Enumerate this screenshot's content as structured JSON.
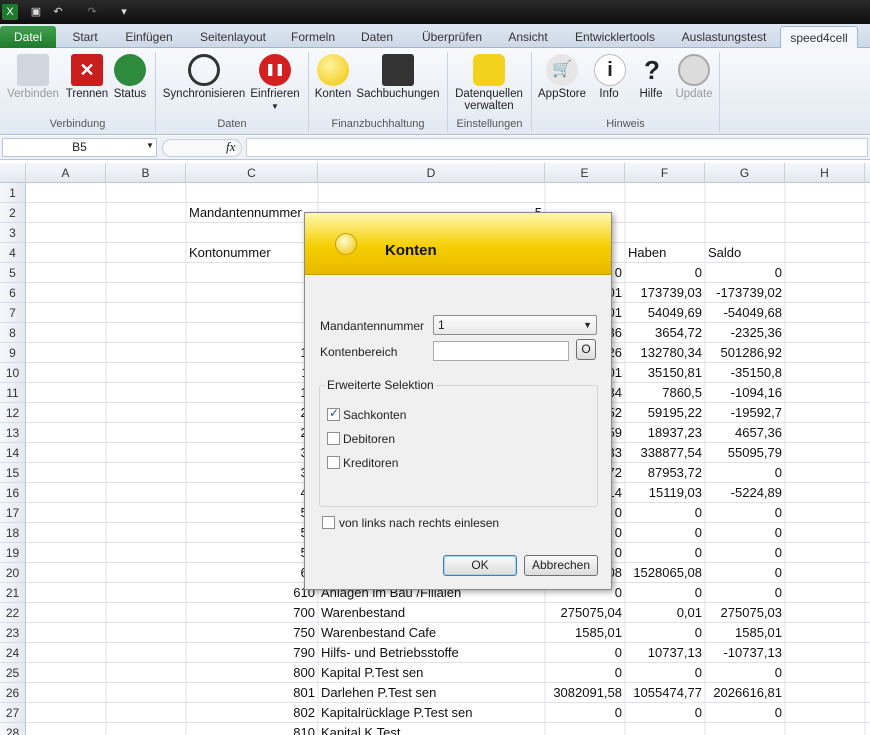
{
  "quick_access": {
    "save": "save-icon",
    "undo": "undo-icon",
    "redo": "redo-icon"
  },
  "tabs": [
    {
      "label": "Datei"
    },
    {
      "label": "Start"
    },
    {
      "label": "Einfügen"
    },
    {
      "label": "Seitenlayout"
    },
    {
      "label": "Formeln"
    },
    {
      "label": "Daten"
    },
    {
      "label": "Überprüfen"
    },
    {
      "label": "Ansicht"
    },
    {
      "label": "Entwicklertools"
    },
    {
      "label": "Auslastungstest"
    },
    {
      "label": "speed4cell"
    }
  ],
  "ribbon": {
    "buttons": [
      "Verbinden",
      "Trennen",
      "Status",
      "Synchronisieren",
      "Einfrieren",
      "Konten",
      "Sachbuchungen",
      "Datenquellen",
      "verwalten",
      "AppStore",
      "Info",
      "Hilfe",
      "Update"
    ],
    "groups": [
      "Verbindung",
      "Daten",
      "Finanzbuchhaltung",
      "Einstellungen",
      "Hinweis"
    ]
  },
  "formula_bar": {
    "name_box": "B5",
    "fx": "fx"
  },
  "columns": [
    "A",
    "B",
    "C",
    "D",
    "E",
    "F",
    "G",
    "H"
  ],
  "rows": [
    "1",
    "2",
    "3",
    "4",
    "5",
    "6",
    "7",
    "8",
    "9",
    "10",
    "11",
    "12",
    "13",
    "14",
    "15",
    "16",
    "17",
    "18",
    "19",
    "20",
    "21",
    "22",
    "23",
    "24",
    "25",
    "26",
    "27",
    "28"
  ],
  "sheet": {
    "r2": {
      "c": "Mandantennummer",
      "e_partial": "5"
    },
    "r4": {
      "c": "Kontonummer",
      "f": "Haben",
      "g": "Saldo"
    },
    "c_partial": [
      "1",
      "2",
      "3",
      "4",
      "10",
      "11",
      "12",
      "20",
      "21",
      "30",
      "31",
      "40",
      "50",
      "51",
      "52",
      "60"
    ],
    "e_partial": [
      "0",
      "01",
      "01",
      "36",
      "26",
      "01",
      "34",
      "52",
      "59",
      "33",
      "72",
      "14",
      "0",
      "0",
      "0",
      "08",
      "0"
    ],
    "f_vals": [
      "0",
      "173739,03",
      "54049,69",
      "3654,72",
      "132780,34",
      "35150,81",
      "7860,5",
      "59195,22",
      "18937,23",
      "338877,54",
      "87953,72",
      "15119,03",
      "0",
      "0",
      "0",
      "1528065,08",
      "0"
    ],
    "g_vals": [
      "0",
      "-173739,02",
      "-54049,68",
      "-2325,36",
      "501286,92",
      "-35150,8",
      "-1094,16",
      "-19592,7",
      "4657,36",
      "55095,79",
      "0",
      "-5224,89",
      "0",
      "0",
      "0",
      "0",
      "0"
    ],
    "lower": [
      {
        "c": "610",
        "d": "Anlagen im Bau /Filialen",
        "e": "",
        "f": "",
        "g": ""
      },
      {
        "c": "700",
        "d": "Warenbestand",
        "e": "275075,04",
        "f": "0,01",
        "g": "275075,03"
      },
      {
        "c": "750",
        "d": "Warenbestand Cafe",
        "e": "1585,01",
        "f": "0",
        "g": "1585,01"
      },
      {
        "c": "790",
        "d": "Hilfs- und Betriebsstoffe",
        "e": "0",
        "f": "10737,13",
        "g": "-10737,13"
      },
      {
        "c": "800",
        "d": "Kapital P.Test sen",
        "e": "0",
        "f": "0",
        "g": "0"
      },
      {
        "c": "801",
        "d": "Darlehen P.Test sen",
        "e": "3082091,58",
        "f": "1055474,77",
        "g": "2026616,81"
      },
      {
        "c": "802",
        "d": "Kapitalrücklage P.Test sen",
        "e": "0",
        "f": "0",
        "g": "0"
      },
      {
        "c": "810",
        "d": "Kapital K.Test",
        "e": "",
        "f": "",
        "g": ""
      }
    ]
  },
  "dialog": {
    "title": "Konten",
    "mandant_label": "Mandantennummer",
    "mandant_value": "1",
    "kontenbereich_label": "Kontenbereich",
    "kontenbereich_value": "",
    "o_button": "O",
    "group_title": "Erweiterte Selektion",
    "sachkonten": "Sachkonten",
    "debitoren": "Debitoren",
    "kreditoren": "Kreditoren",
    "links_rechts": "von links nach rechts einlesen",
    "ok": "OK",
    "cancel": "Abbrechen"
  }
}
